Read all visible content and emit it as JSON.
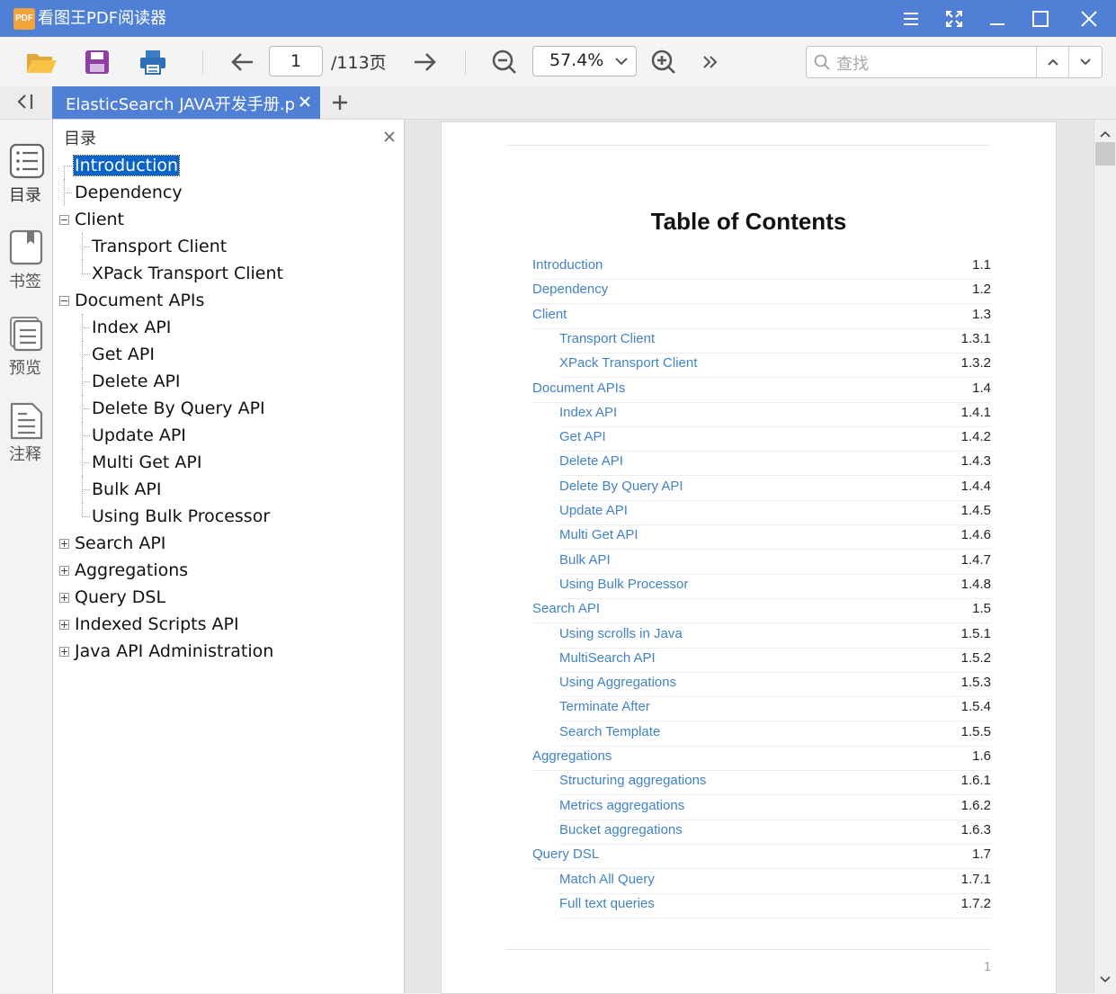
{
  "app": {
    "logo_text": "PDF",
    "title": "看图王PDF阅读器"
  },
  "toolbar": {
    "page_current": "1",
    "page_total": "/113页",
    "zoom": "57.4%",
    "search_placeholder": "查找"
  },
  "tab": {
    "label": "ElasticSearch JAVA开发手册.pdf"
  },
  "rail": {
    "items": [
      {
        "label": "目录",
        "icon": "list-icon"
      },
      {
        "label": "书签",
        "icon": "bookmark-icon"
      },
      {
        "label": "预览",
        "icon": "pages-icon"
      },
      {
        "label": "注释",
        "icon": "note-icon"
      }
    ]
  },
  "outline": {
    "title": "目录",
    "items": [
      {
        "label": "Introduction",
        "level": 1,
        "selected": true
      },
      {
        "label": "Dependency",
        "level": 1
      },
      {
        "label": "Client",
        "level": 1,
        "expander": "minus"
      },
      {
        "label": "Transport Client",
        "level": 2
      },
      {
        "label": "XPack Transport Client",
        "level": 2
      },
      {
        "label": "Document APIs",
        "level": 1,
        "expander": "minus"
      },
      {
        "label": "Index API",
        "level": 2
      },
      {
        "label": "Get API",
        "level": 2
      },
      {
        "label": "Delete API",
        "level": 2
      },
      {
        "label": "Delete By Query API",
        "level": 2
      },
      {
        "label": "Update API",
        "level": 2
      },
      {
        "label": "Multi Get API",
        "level": 2
      },
      {
        "label": "Bulk API",
        "level": 2
      },
      {
        "label": "Using Bulk Processor",
        "level": 2
      },
      {
        "label": "Search API",
        "level": 1,
        "expander": "plus"
      },
      {
        "label": "Aggregations",
        "level": 1,
        "expander": "plus"
      },
      {
        "label": "Query DSL",
        "level": 1,
        "expander": "plus"
      },
      {
        "label": "Indexed Scripts API",
        "level": 1,
        "expander": "plus"
      },
      {
        "label": "Java API Administration",
        "level": 1,
        "expander": "plus"
      }
    ]
  },
  "document": {
    "toc_title": "Table of Contents",
    "page_number": "1",
    "toc": [
      {
        "title": "Introduction",
        "num": "1.1",
        "level": 1
      },
      {
        "title": "Dependency",
        "num": "1.2",
        "level": 1
      },
      {
        "title": "Client",
        "num": "1.3",
        "level": 1
      },
      {
        "title": "Transport Client",
        "num": "1.3.1",
        "level": 2
      },
      {
        "title": "XPack Transport Client",
        "num": "1.3.2",
        "level": 2
      },
      {
        "title": "Document APIs",
        "num": "1.4",
        "level": 1
      },
      {
        "title": "Index API",
        "num": "1.4.1",
        "level": 2
      },
      {
        "title": "Get API",
        "num": "1.4.2",
        "level": 2
      },
      {
        "title": "Delete API",
        "num": "1.4.3",
        "level": 2
      },
      {
        "title": "Delete By Query API",
        "num": "1.4.4",
        "level": 2
      },
      {
        "title": "Update API",
        "num": "1.4.5",
        "level": 2
      },
      {
        "title": "Multi Get API",
        "num": "1.4.6",
        "level": 2
      },
      {
        "title": "Bulk API",
        "num": "1.4.7",
        "level": 2
      },
      {
        "title": "Using Bulk Processor",
        "num": "1.4.8",
        "level": 2
      },
      {
        "title": "Search API",
        "num": "1.5",
        "level": 1
      },
      {
        "title": "Using scrolls in Java",
        "num": "1.5.1",
        "level": 2
      },
      {
        "title": "MultiSearch API",
        "num": "1.5.2",
        "level": 2
      },
      {
        "title": "Using Aggregations",
        "num": "1.5.3",
        "level": 2
      },
      {
        "title": "Terminate After",
        "num": "1.5.4",
        "level": 2
      },
      {
        "title": "Search Template",
        "num": "1.5.5",
        "level": 2
      },
      {
        "title": "Aggregations",
        "num": "1.6",
        "level": 1
      },
      {
        "title": "Structuring aggregations",
        "num": "1.6.1",
        "level": 2
      },
      {
        "title": "Metrics aggregations",
        "num": "1.6.2",
        "level": 2
      },
      {
        "title": "Bucket aggregations",
        "num": "1.6.3",
        "level": 2
      },
      {
        "title": "Query DSL",
        "num": "1.7",
        "level": 1
      },
      {
        "title": "Match All Query",
        "num": "1.7.1",
        "level": 2
      },
      {
        "title": "Full text queries",
        "num": "1.7.2",
        "level": 2
      }
    ]
  },
  "colors": {
    "accent": "#4f80d6",
    "link": "#4183c4",
    "selection": "#0a64c8"
  }
}
